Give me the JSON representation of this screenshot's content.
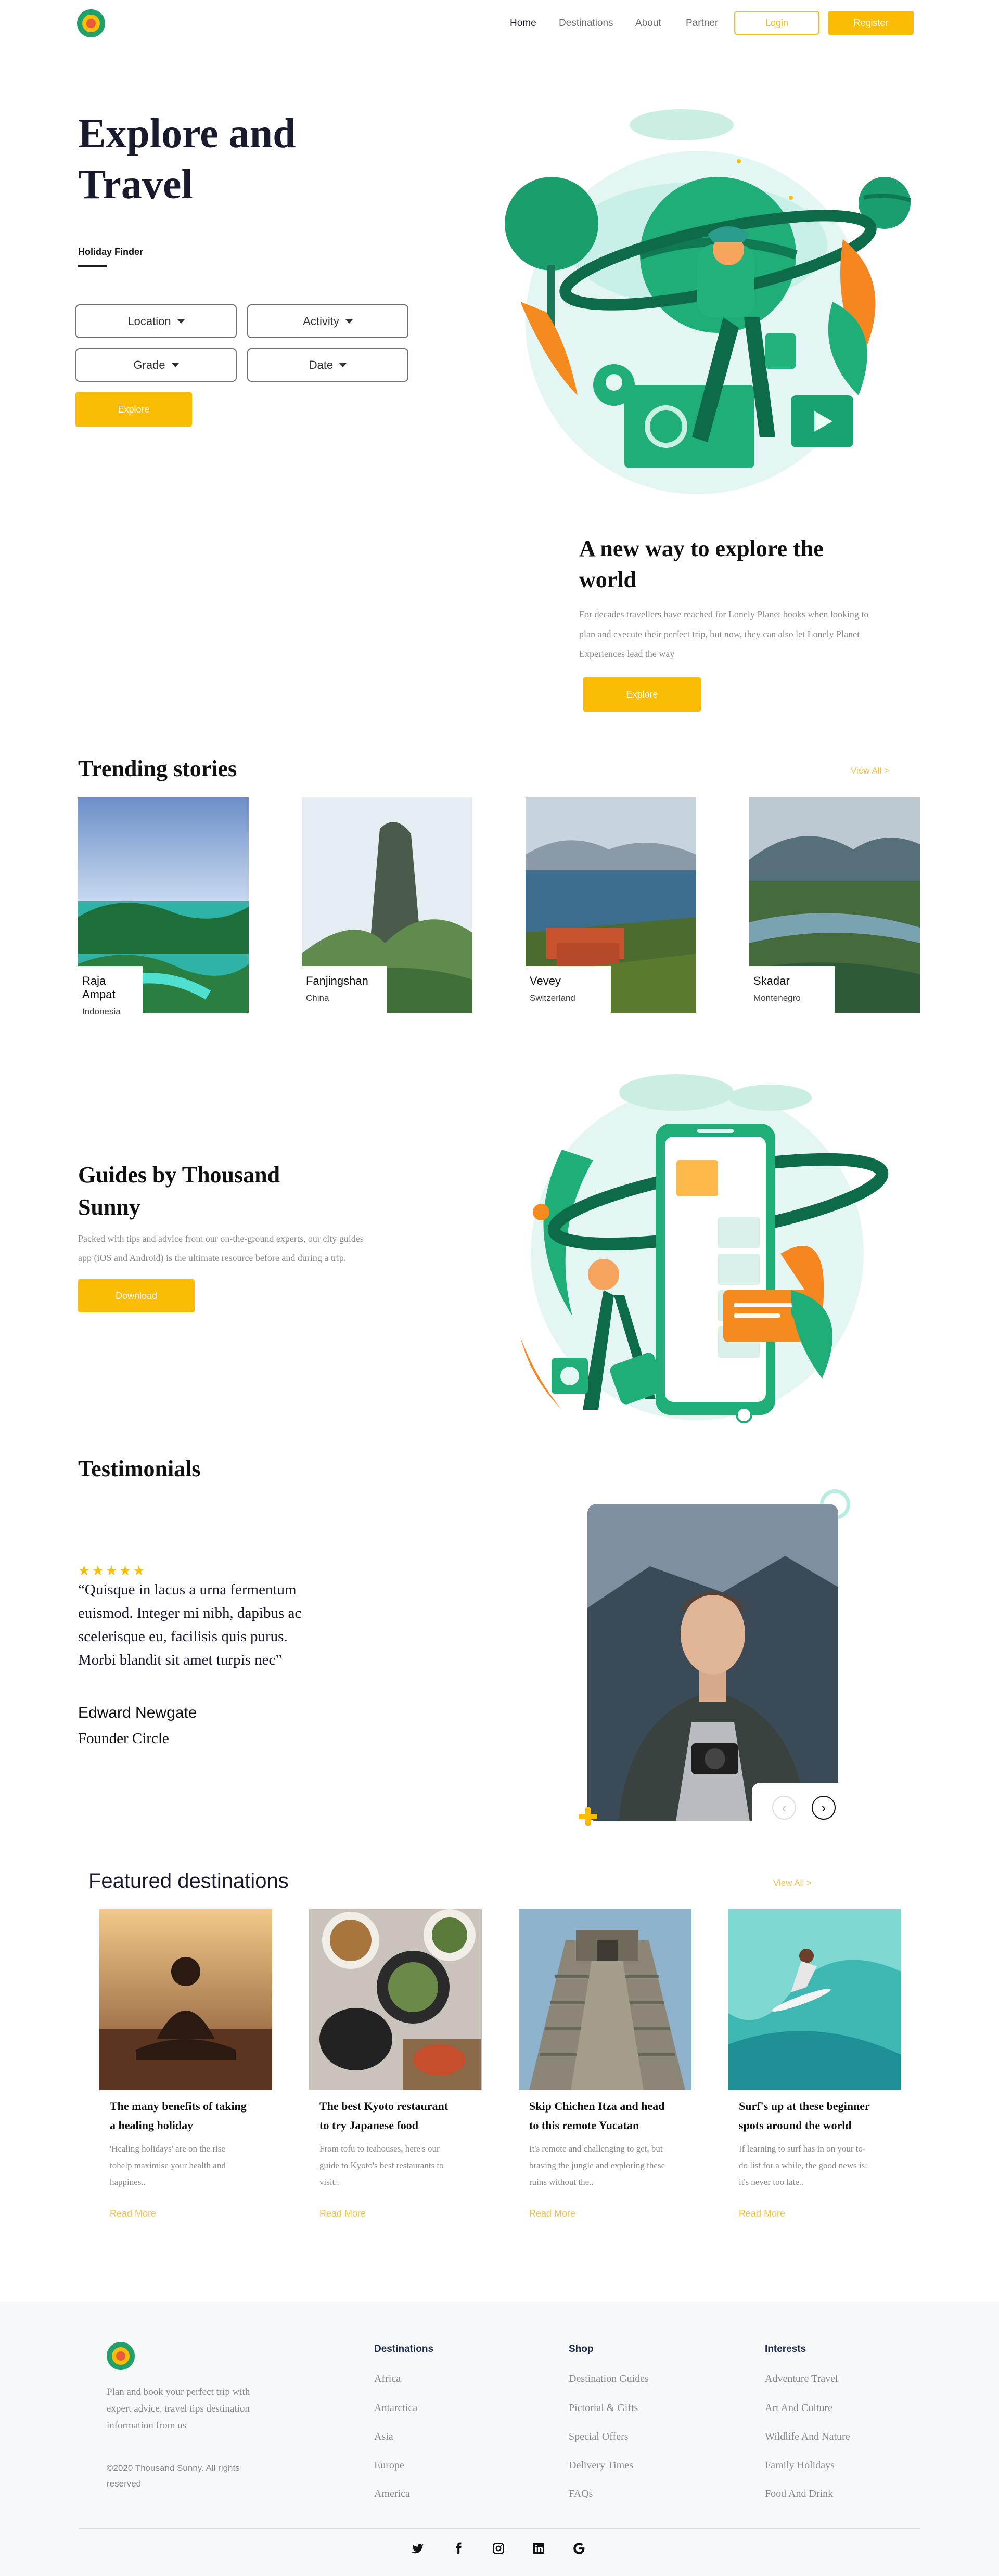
{
  "nav": {
    "items": [
      "Home",
      "Destinations",
      "About",
      "Partner"
    ],
    "login": "Login",
    "register": "Register"
  },
  "hero": {
    "title_line1": "Explore and",
    "title_line2": "Travel",
    "finder_label": "Holiday Finder",
    "filters": [
      "Location",
      "Activity",
      "Grade",
      "Date"
    ],
    "explore_button": "Explore"
  },
  "new_way": {
    "title_line1": "A new way to explore the",
    "title_line2": "world",
    "text_line1": "For decades travellers have reached for Lonely Planet books when looking to",
    "text_line2": "plan and execute their perfect trip, but now, they can also let Lonely Planet",
    "text_line3": "Experiences lead the way",
    "button": "Explore"
  },
  "trending": {
    "title": "Trending stories",
    "view_all": "View All >",
    "stories": [
      {
        "name": "Raja Ampat",
        "country": "Indonesia"
      },
      {
        "name": "Fanjingshan",
        "country": "China"
      },
      {
        "name": "Vevey",
        "country": "Switzerland"
      },
      {
        "name": "Skadar",
        "country": "Montenegro"
      }
    ]
  },
  "guides": {
    "title_line1": "Guides by Thousand",
    "title_line2": "Sunny",
    "text_line1": "Packed with tips and advice from our on-the-ground experts, our city guides",
    "text_line2": "app (iOS and Android) is the ultimate resource before and during a trip.",
    "button": "Download"
  },
  "testimonials": {
    "title": "Testimonials",
    "stars": "★★★★★",
    "quote_line1": "“Quisque in lacus a urna fermentum",
    "quote_line2": "euismod. Integer mi nibh, dapibus ac",
    "quote_line3": "scelerisque eu, facilisis quis purus.",
    "quote_line4": "Morbi blandit sit amet turpis nec”",
    "author": "Edward Newgate",
    "role": "Founder Circle",
    "prev": "‹",
    "next": "›"
  },
  "featured": {
    "title": "Featured destinations",
    "view_all": "View All >",
    "read_more": "Read More",
    "items": [
      {
        "t1": "The many benefits of taking",
        "t2": "a healing holiday",
        "d1": "'Healing holidays' are on the rise",
        "d2": "tohelp maximise your health and",
        "d3": "happines.."
      },
      {
        "t1": "The best Kyoto restaurant",
        "t2": "to try Japanese food",
        "d1": "From tofu to teahouses, here's our",
        "d2": "guide to Kyoto's best restaurants to",
        "d3": "visit.."
      },
      {
        "t1": "Skip Chichen Itza and head",
        "t2": "to this remote Yucatan",
        "d1": "It's remote and challenging to get, but",
        "d2": "braving the jungle and exploring these",
        "d3": "ruins without the.."
      },
      {
        "t1": "Surf's up at these beginner",
        "t2": "spots around the world",
        "d1": "If learning to surf has in on your to-",
        "d2": "do list for a while, the good news is:",
        "d3": "it's never too late.."
      }
    ]
  },
  "footer": {
    "about_line1": "Plan and book your perfect trip with",
    "about_line2": "expert advice, travel tips destination",
    "about_line3": "information from us",
    "copyright_line1": "©2020 Thousand Sunny. All rights",
    "copyright_line2": "reserved",
    "columns": [
      {
        "heading": "Destinations",
        "links": [
          "Africa",
          "Antarctica",
          "Asia",
          "Europe",
          "America"
        ]
      },
      {
        "heading": "Shop",
        "links": [
          "Destination Guides",
          "Pictorial & Gifts",
          "Special Offers",
          "Delivery Times",
          "FAQs"
        ]
      },
      {
        "heading": "Interests",
        "links": [
          "Adventure Travel",
          "Art And Culture",
          "Wildlife And Nature",
          "Family Holidays",
          "Food And Drink"
        ]
      }
    ],
    "social": [
      "twitter-icon",
      "facebook-icon",
      "instagram-icon",
      "linkedin-icon",
      "google-icon"
    ]
  },
  "colors": {
    "accent": "#fbbc05",
    "brand_green": "#1a9e6b",
    "dark": "#1a1a2e",
    "footer_bg": "#f7f8fa"
  }
}
